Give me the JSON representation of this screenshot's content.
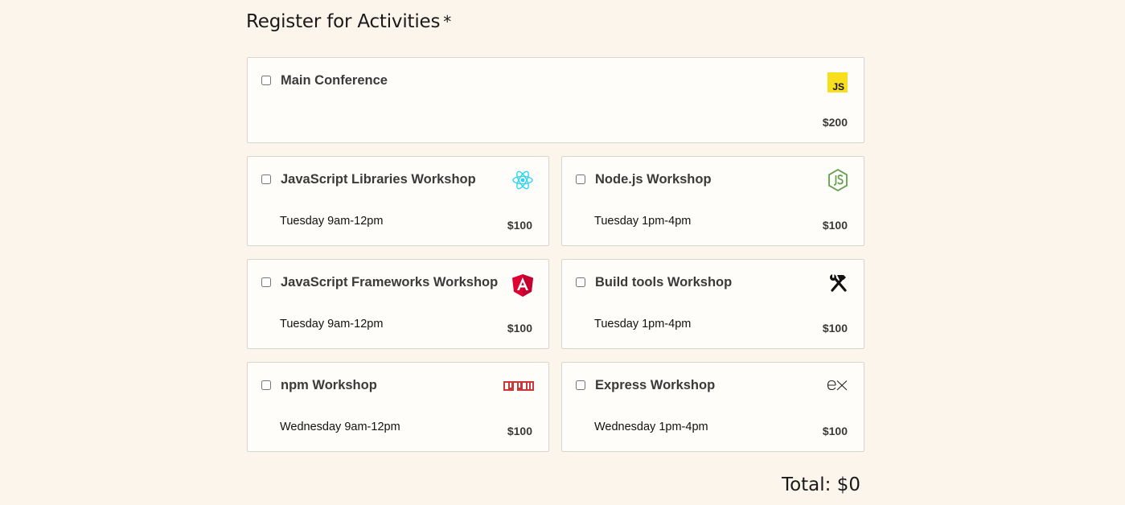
{
  "section": {
    "title": "Register for Activities",
    "required_mark": "*"
  },
  "activities": [
    {
      "name": "Main Conference",
      "time": "",
      "price": "$200",
      "icon": "javascript-logo-icon",
      "icon_text": "JS",
      "checked": false
    },
    {
      "name": "JavaScript Libraries Workshop",
      "time": "Tuesday 9am-12pm",
      "price": "$100",
      "icon": "react-logo-icon",
      "checked": false
    },
    {
      "name": "Node.js Workshop",
      "time": "Tuesday 1pm-4pm",
      "price": "$100",
      "icon": "nodejs-logo-icon",
      "checked": false
    },
    {
      "name": "JavaScript Frameworks Workshop",
      "time": "Tuesday 9am-12pm",
      "price": "$100",
      "icon": "angular-logo-icon",
      "checked": false
    },
    {
      "name": "Build tools Workshop",
      "time": "Tuesday 1pm-4pm",
      "price": "$100",
      "icon": "hammer-wrench-icon",
      "checked": false
    },
    {
      "name": "npm Workshop",
      "time": "Wednesday 9am-12pm",
      "price": "$100",
      "icon": "npm-logo-icon",
      "checked": false
    },
    {
      "name": "Express Workshop",
      "time": "Wednesday 1pm-4pm",
      "price": "$100",
      "icon": "express-logo-icon",
      "checked": false
    }
  ],
  "total": {
    "label": "Total: $0"
  },
  "colors": {
    "background": "#fcf5ec",
    "card": "#fffdf9",
    "js_yellow": "#f7df1e",
    "react_cyan": "#2fd3f3",
    "node_green": "#5fa04e",
    "angular_red": "#dd0031",
    "npm_red": "#cb3837"
  }
}
